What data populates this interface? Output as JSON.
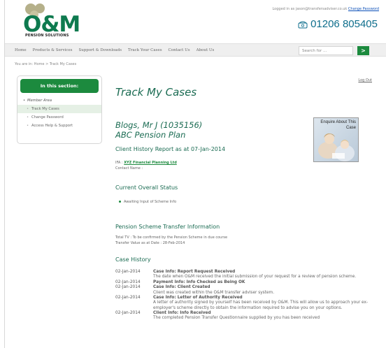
{
  "brand": {
    "name": "O&M",
    "tagline": "PENSION SOLUTIONS",
    "logo_color": "#0e7a4f",
    "accent": "#1c8a3e"
  },
  "header": {
    "logged_in_text": "Logged in as jason@transfersadviser.co.uk",
    "change_password": "Change Password",
    "phone": "01206 805405"
  },
  "nav": {
    "items": [
      "Home",
      "Products & Services",
      "Support & Downloads",
      "Track Your Cases",
      "Contact Us",
      "About Us"
    ],
    "search_placeholder": "Search for ...",
    "search_button": ">"
  },
  "breadcrumb": "You are in: Home > Track My Cases",
  "logout": "Log Out",
  "sidebar": {
    "title": "In this section:",
    "items": [
      "Member Area",
      "Track My Cases",
      "Change Password",
      "Access Help & Support"
    ]
  },
  "main": {
    "title": "Track My Cases",
    "client_name": "Blogs, Mr J (1035156)",
    "plan": "ABC Pension Plan",
    "report_heading": "Client History Report as at 07-Jan-2014",
    "ifa_label": "IFA :",
    "ifa_value": "XYZ Financial Planning Ltd",
    "contact_label": "Contact Name :",
    "enquire_label": "Enquire About This Case",
    "status_heading": "Current Overall Status",
    "status_value": "Awaiting Input of Scheme Info",
    "transfer_heading": "Pension Scheme Transfer Information",
    "total_tv": "Total TV : To be confirmed by the Pension Scheme in due course",
    "transfer_value_date": "Transfer Value as at Date : 28-Feb-2014",
    "history_heading": "Case History",
    "history": [
      {
        "date": "02-Jan-2014",
        "title": "Case Info: Report Request Received",
        "desc": "The date when O&M received the initial submission of your request for a review of pension scheme."
      },
      {
        "date": "02-Jan-2014",
        "title": "Payment Info: Info Checked as Being OK",
        "desc": ""
      },
      {
        "date": "02-Jan-2014",
        "title": "Case Info: Client Created",
        "desc": "Client was created within the O&M transfer adviser system."
      },
      {
        "date": "02-Jan-2014",
        "title": "Case Info: Letter of Authority Received",
        "desc": "A letter of authority signed by yourself has been received by O&M. This will allow us to approach your ex-employer's scheme directly to obtain the information required to advise you on your options."
      },
      {
        "date": "02-Jan-2014",
        "title": "Client Info: Info Received",
        "desc": "The completed Pension Transfer Questionnaire supplied by you has been received"
      }
    ]
  }
}
